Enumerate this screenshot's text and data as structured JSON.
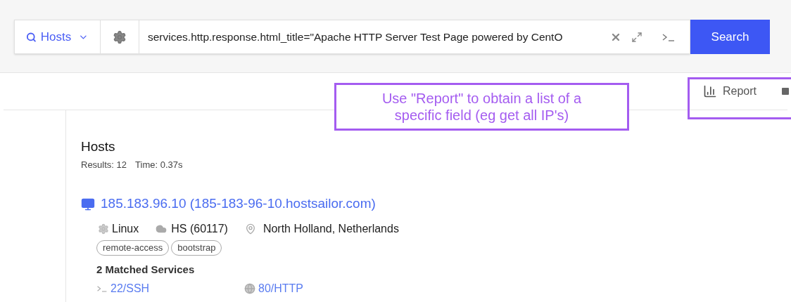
{
  "search_bar": {
    "scope": "Hosts",
    "query": "services.http.response.html_title=\"Apache HTTP Server Test Page powered by CentO",
    "button": "Search"
  },
  "toolbar": {
    "report": "Report"
  },
  "annotation": {
    "text": "Use \"Report\" to obtain a list of a specific field (eg get all IP's)"
  },
  "results": {
    "title": "Hosts",
    "summary": [
      "Results: 12",
      "Time: 0.37s"
    ],
    "hosts": [
      {
        "address": "185.183.96.10 (185-183-96-10.hostsailor.com)",
        "os": "Linux",
        "network": "HS (60117)",
        "location": "North Holland, Netherlands",
        "tags": [
          "remote-access",
          "bootstrap"
        ],
        "matched": "2 Matched Services",
        "services": [
          {
            "kind": "terminal",
            "label": "22/SSH"
          },
          {
            "kind": "globe",
            "label": "80/HTTP"
          }
        ]
      }
    ]
  }
}
